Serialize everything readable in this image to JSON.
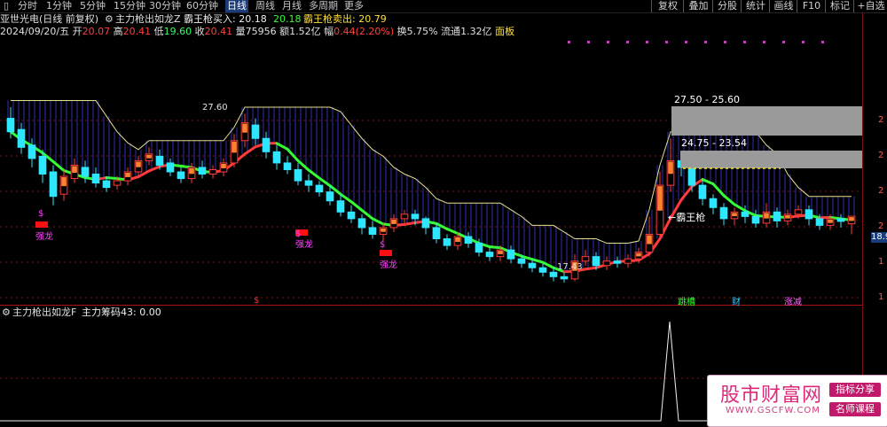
{
  "toolbar": {
    "periods": [
      "分时",
      "1分钟",
      "5分钟",
      "15分钟",
      "30分钟",
      "60分钟",
      "日线",
      "周线",
      "月线",
      "多周期",
      "更多"
    ],
    "active_period": "日线",
    "buttons": [
      "复权",
      "叠加",
      "分股",
      "统计",
      "画线",
      "F10",
      "标记",
      "+自选"
    ]
  },
  "header": {
    "stock_name": "亚世光电(日线 前复权)",
    "indicator_name": "主力枪出如龙Z",
    "buy_label": "霸王枪买入: 20.18",
    "buy_value2": "20.18",
    "sell_label": "霸王枪卖出: 20.79"
  },
  "quote": {
    "date": "2024/09/20/五",
    "open_label": "开",
    "open": "20.07",
    "high_label": "高",
    "high": "20.41",
    "low_label": "低",
    "low": "19.60",
    "close_label": "收",
    "close": "20.41",
    "volume_label": "量",
    "volume": "75956",
    "amount_label": "额",
    "amount": "1.52亿",
    "change_label": "幅",
    "change": "0.44(2.20%)",
    "turnover_label": "换",
    "turnover": "5.75%",
    "float_label": "流通",
    "float": "1.32亿",
    "panel": "面板"
  },
  "annotations": {
    "high_mark": "27.60",
    "low_mark": "17.43",
    "zone1": "27.50 - 25.60",
    "zone2": "24.75 - 23.54",
    "arrow_label": "←霸王枪",
    "dragon": "强龙",
    "dollar": "$",
    "tag_a": "跳槽",
    "tag_b": "财",
    "tag_c": "涨减",
    "price_tag": "18.9"
  },
  "right_axis": [
    "2",
    "2",
    "2",
    "2",
    "1",
    "1",
    "1"
  ],
  "sub": {
    "title": "主力枪出如龙F",
    "value_label": "主力筹码43: 0.00"
  },
  "watermark": {
    "brand": "股市财富网",
    "url": "WWW.GSCFW.COM",
    "badge1": "指标分享",
    "badge2": "名师课程"
  },
  "colors": {
    "up": "#ff3b3b",
    "down": "#2ee6ff",
    "support": "#33ff33",
    "resist": "#ff3b3b",
    "band_fill": "#3b3bd6",
    "grid": "#7a1010"
  },
  "chart_data": {
    "type": "candlestick",
    "candles": [
      [
        24.8,
        24.2,
        25.3,
        23.9
      ],
      [
        24.3,
        23.5,
        24.6,
        23.2
      ],
      [
        23.6,
        23.0,
        23.9,
        22.6
      ],
      [
        23.1,
        22.3,
        23.4,
        21.9
      ],
      [
        22.4,
        21.3,
        22.7,
        20.9
      ],
      [
        21.4,
        22.2,
        22.5,
        21.1
      ],
      [
        22.1,
        22.7,
        23.0,
        21.9
      ],
      [
        22.6,
        22.2,
        22.9,
        21.9
      ],
      [
        22.3,
        21.9,
        22.6,
        21.7
      ],
      [
        22.0,
        21.7,
        22.2,
        21.5
      ],
      [
        21.8,
        22.0,
        22.2,
        21.6
      ],
      [
        22.0,
        22.4,
        22.6,
        21.8
      ],
      [
        22.4,
        22.9,
        23.1,
        22.2
      ],
      [
        22.9,
        23.2,
        23.5,
        22.7
      ],
      [
        23.1,
        22.7,
        23.4,
        22.5
      ],
      [
        22.8,
        22.4,
        23.0,
        22.2
      ],
      [
        22.4,
        22.1,
        22.6,
        21.9
      ],
      [
        22.1,
        22.6,
        22.8,
        21.9
      ],
      [
        22.6,
        22.3,
        22.9,
        22.1
      ],
      [
        22.3,
        22.5,
        22.7,
        22.1
      ],
      [
        22.4,
        22.8,
        23.0,
        22.2
      ],
      [
        22.8,
        23.8,
        24.1,
        22.6
      ],
      [
        23.8,
        24.6,
        25.0,
        23.5
      ],
      [
        24.5,
        23.9,
        24.8,
        23.6
      ],
      [
        23.9,
        23.3,
        24.2,
        23.0
      ],
      [
        23.3,
        22.8,
        23.6,
        22.5
      ],
      [
        22.8,
        22.5,
        23.1,
        22.3
      ],
      [
        22.5,
        22.0,
        22.8,
        21.8
      ],
      [
        22.0,
        21.8,
        22.3,
        21.5
      ],
      [
        21.8,
        21.5,
        22.0,
        21.3
      ],
      [
        21.5,
        21.1,
        21.8,
        20.9
      ],
      [
        21.1,
        20.6,
        21.4,
        20.4
      ],
      [
        20.6,
        20.3,
        20.9,
        20.1
      ],
      [
        20.3,
        19.9,
        20.5,
        19.6
      ],
      [
        19.9,
        19.6,
        20.2,
        19.4
      ],
      [
        19.6,
        19.9,
        20.1,
        19.3
      ],
      [
        19.9,
        20.3,
        20.5,
        19.7
      ],
      [
        20.3,
        20.5,
        20.7,
        20.1
      ],
      [
        20.5,
        20.3,
        20.7,
        20.0
      ],
      [
        20.3,
        19.9,
        20.4,
        19.6
      ],
      [
        19.9,
        19.4,
        20.1,
        19.2
      ],
      [
        19.4,
        19.1,
        19.6,
        18.9
      ],
      [
        19.1,
        19.5,
        19.7,
        18.9
      ],
      [
        19.5,
        19.2,
        19.7,
        19.0
      ],
      [
        19.2,
        18.8,
        19.4,
        18.6
      ],
      [
        18.8,
        18.6,
        19.0,
        18.4
      ],
      [
        18.6,
        18.9,
        19.1,
        18.4
      ],
      [
        18.9,
        18.5,
        19.1,
        18.3
      ],
      [
        18.5,
        18.3,
        18.7,
        18.1
      ],
      [
        18.3,
        18.1,
        18.5,
        17.9
      ],
      [
        18.1,
        17.9,
        18.3,
        17.7
      ],
      [
        17.9,
        17.7,
        18.1,
        17.5
      ],
      [
        17.7,
        17.6,
        17.9,
        17.43
      ],
      [
        17.6,
        18.4,
        18.7,
        17.5
      ],
      [
        18.4,
        18.6,
        18.9,
        18.2
      ],
      [
        18.6,
        18.2,
        18.8,
        18.0
      ],
      [
        18.2,
        18.4,
        18.6,
        18.0
      ],
      [
        18.4,
        18.3,
        18.6,
        18.1
      ],
      [
        18.3,
        18.5,
        18.7,
        18.1
      ],
      [
        18.5,
        18.8,
        19.0,
        18.3
      ],
      [
        18.8,
        19.6,
        20.4,
        18.6
      ],
      [
        19.6,
        21.8,
        22.4,
        19.4
      ],
      [
        21.8,
        22.9,
        23.9,
        21.5
      ],
      [
        22.9,
        22.6,
        23.3,
        22.2
      ],
      [
        22.6,
        21.8,
        22.9,
        21.5
      ],
      [
        21.8,
        21.2,
        22.0,
        20.9
      ],
      [
        21.2,
        20.8,
        21.4,
        20.5
      ],
      [
        20.8,
        20.3,
        21.0,
        20.0
      ],
      [
        20.3,
        20.6,
        20.8,
        20.0
      ],
      [
        20.6,
        20.4,
        20.9,
        20.1
      ],
      [
        20.4,
        20.1,
        20.7,
        19.9
      ],
      [
        20.1,
        20.6,
        21.0,
        19.9
      ],
      [
        20.6,
        20.2,
        20.8,
        19.9
      ],
      [
        20.2,
        20.5,
        20.7,
        20.0
      ],
      [
        20.5,
        20.7,
        20.9,
        20.3
      ],
      [
        20.7,
        20.3,
        20.9,
        20.0
      ],
      [
        20.3,
        20.0,
        20.5,
        19.8
      ],
      [
        20.0,
        20.3,
        20.5,
        19.8
      ],
      [
        20.3,
        20.18,
        20.5,
        19.9
      ],
      [
        20.07,
        20.41,
        20.41,
        19.6
      ]
    ]
  }
}
